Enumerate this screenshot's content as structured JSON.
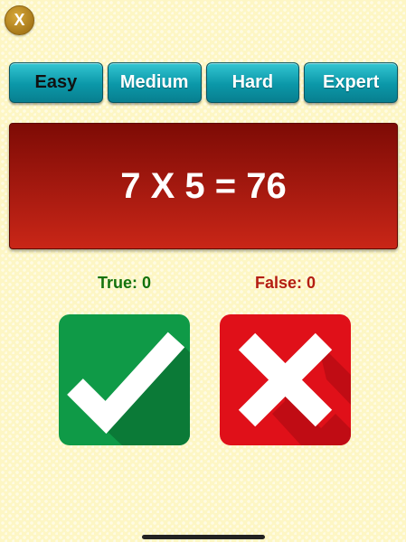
{
  "close_button": {
    "label": "X"
  },
  "levels": [
    {
      "label": "Easy",
      "selected": true
    },
    {
      "label": "Medium",
      "selected": false
    },
    {
      "label": "Hard",
      "selected": false
    },
    {
      "label": "Expert",
      "selected": false
    }
  ],
  "question": {
    "text": "7 X 5 = 76"
  },
  "score": {
    "true_label": "True: 0",
    "false_label": "False: 0"
  },
  "answers": {
    "true_icon": "checkmark-icon",
    "false_icon": "cross-icon"
  },
  "colors": {
    "background": "#fdf6c4",
    "level_button": "#0b97a8",
    "question_panel": "#a71a10",
    "true_color": "#13720d",
    "false_color": "#b41d12",
    "true_button": "#0f9a47",
    "false_button": "#e01019"
  }
}
